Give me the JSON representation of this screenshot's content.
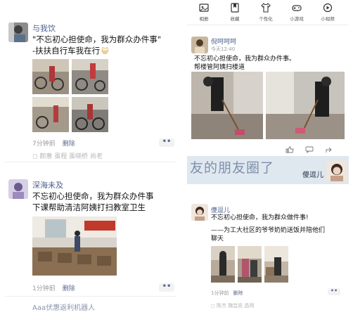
{
  "left": {
    "post1": {
      "name": "与我饮",
      "lines": [
        "\"不忘初心担使命，我为群众办件事\"",
        "-扶扶自行车我在行"
      ],
      "emoji": "😺",
      "time": "7分钟前",
      "delete": "删除",
      "faded": "◻ 颜惠  虽程  虽晓桥  尚老",
      "more": "••"
    },
    "post2": {
      "name": "深海未及",
      "lines": [
        "不忘初心担使命，我为群众办件事",
        "下课帮助清洁阿姨打扫教室卫生"
      ],
      "time": "1分钟前",
      "delete": "删除",
      "more": "••",
      "next_name": "Aaa伏惠返利机器人"
    }
  },
  "right": {
    "icons": [
      {
        "icon": "album-icon",
        "label": "相册"
      },
      {
        "icon": "collection-icon",
        "label": "收藏"
      },
      {
        "icon": "clothes-icon",
        "label": "个性化"
      },
      {
        "icon": "gamepad-icon",
        "label": "小游戏"
      },
      {
        "icon": "video-icon",
        "label": "小视频"
      }
    ],
    "post1": {
      "name": "倪呵呵呵",
      "subtitle": "今天12:40",
      "lines": [
        "不忘初心担使命，我为群众办件事。",
        "帮楼管阿姨扫楼道"
      ]
    },
    "banner": {
      "big_text": "友的朋友圈了",
      "user": "傻逗儿"
    },
    "post2": {
      "name": "傻逗儿",
      "lines": [
        "不忘初心担使命，我为群众做件事!",
        "——为工大社区的爷爷奶奶送饭并陪他们",
        "聊天"
      ],
      "time": "1分钟前",
      "delete": "删除",
      "more": "••",
      "faded": "◻ 陈杰  魏芸凯  昌明"
    },
    "accent": "#576b95"
  }
}
